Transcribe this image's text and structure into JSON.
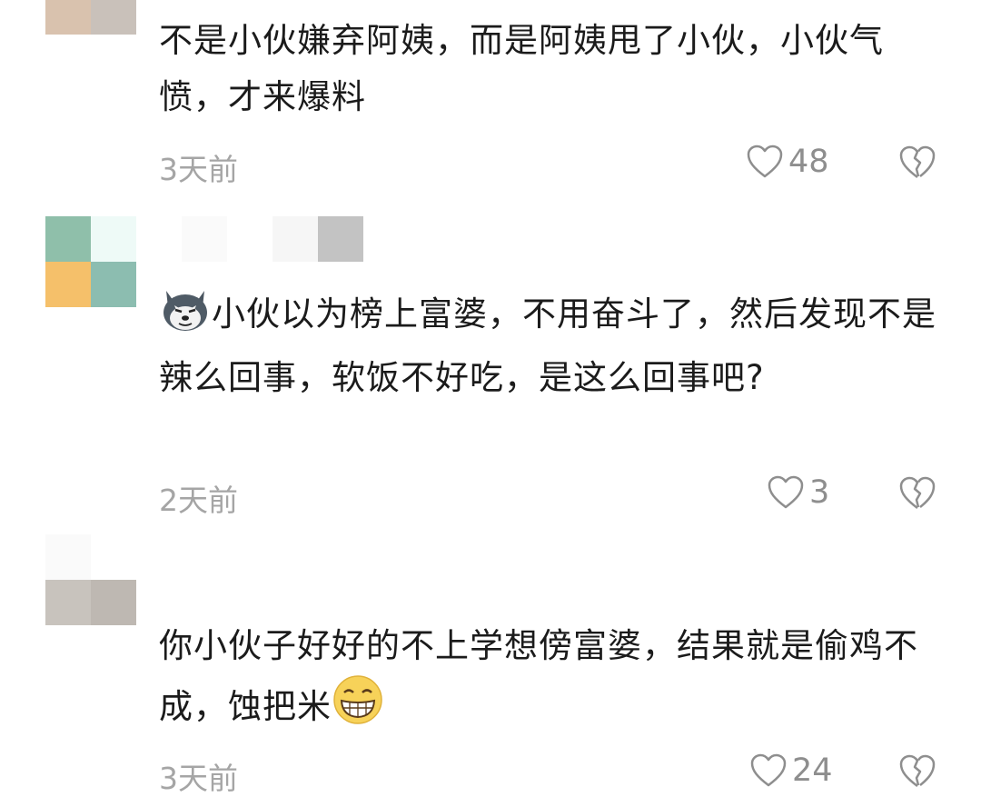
{
  "comments": [
    {
      "text_before_emoji": "",
      "text": "不是小伙嫌弃阿姨，而是阿姨甩了小伙，小伙气愤，才来爆料",
      "time": "3天前",
      "likes": "48",
      "leading_emoji": null,
      "trailing_emoji": null
    },
    {
      "text": "小伙以为榜上富婆，不用奋斗了，然后发现不是辣么回事，软饭不好吃，是这么回事吧?",
      "time": "2天前",
      "likes": "3",
      "leading_emoji": "husky-dog-emoji",
      "trailing_emoji": null
    },
    {
      "text": "你小伙子好好的不上学想傍富婆，结果就是偷鸡不成，蚀把米",
      "time": "3天前",
      "likes": "24",
      "leading_emoji": null,
      "trailing_emoji": "grinning-face-emoji"
    }
  ],
  "icons": {
    "like": "heart-outline-icon",
    "dislike": "broken-heart-icon"
  },
  "colors": {
    "text": "#1b1b1b",
    "meta": "#a5a5a5",
    "icon": "#8e8e8e"
  }
}
